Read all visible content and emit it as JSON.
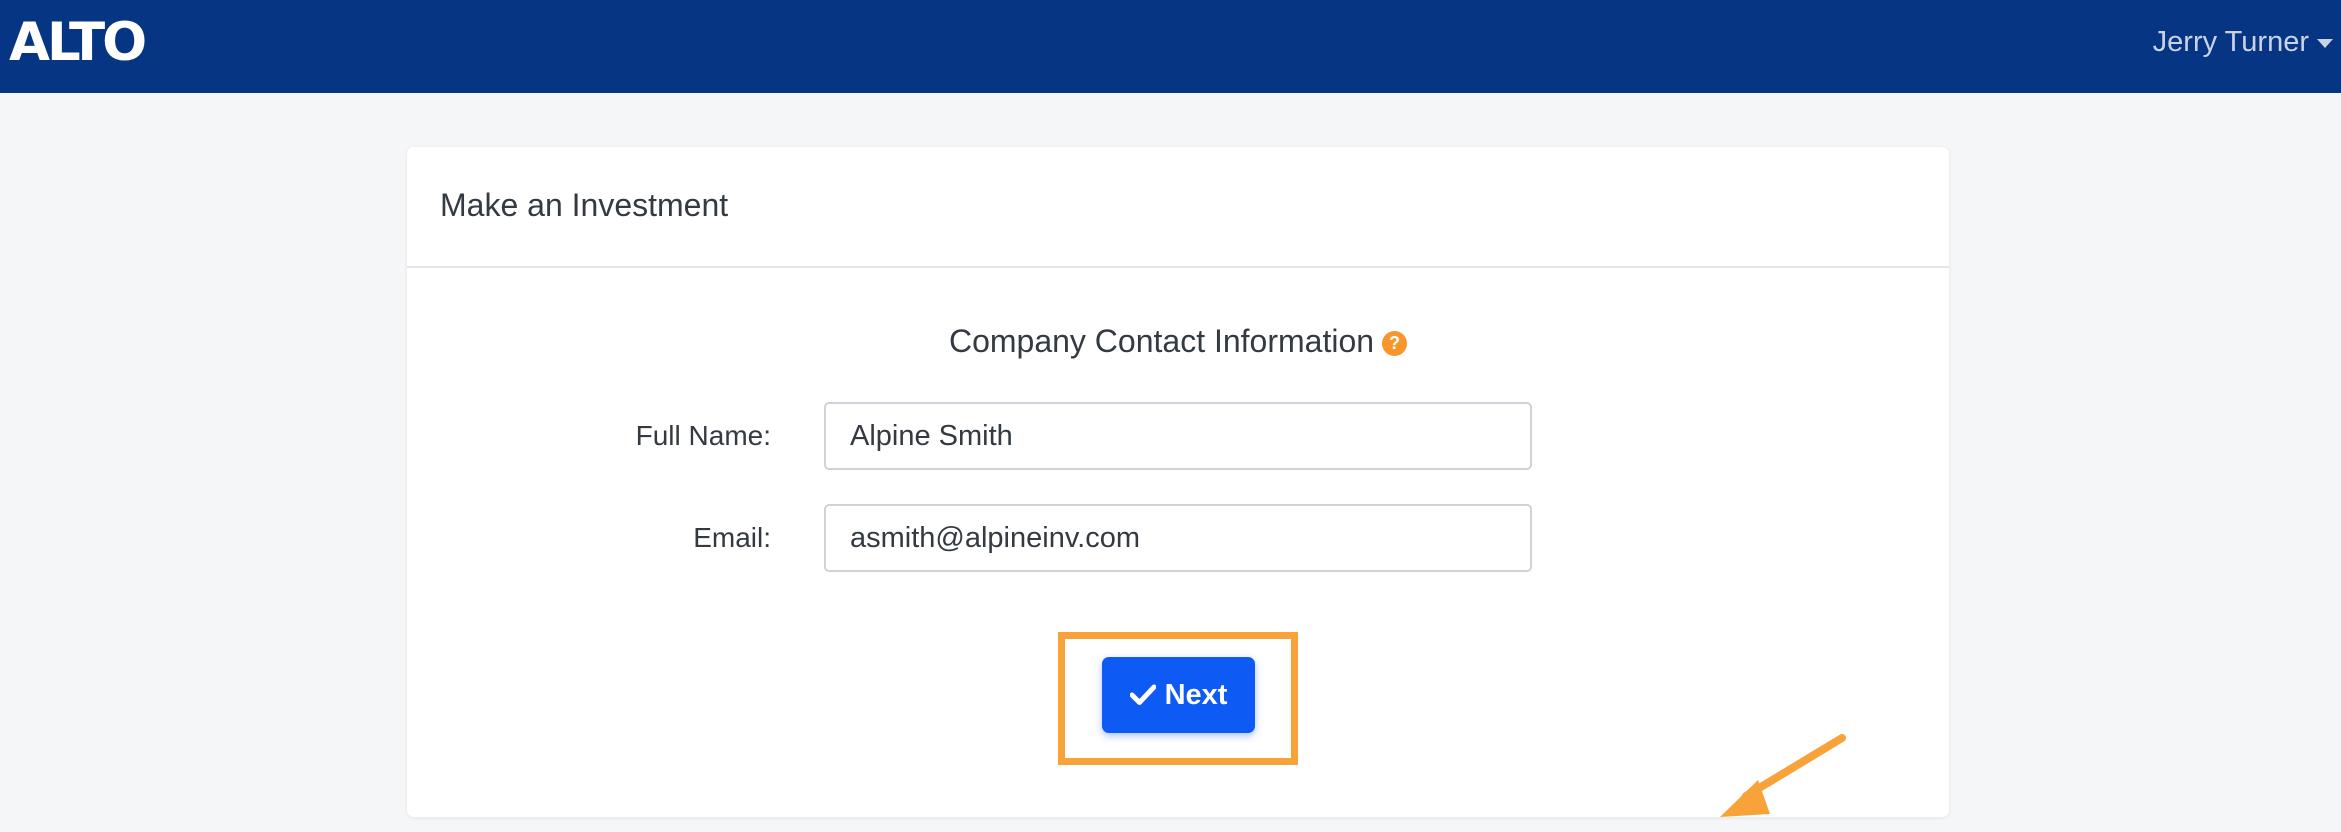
{
  "nav": {
    "logo_text": "ALTO",
    "user_name": "Jerry Turner"
  },
  "card": {
    "title": "Make an Investment",
    "section_title": "Company Contact Information",
    "help_icon": "question-circle-icon",
    "fields": [
      {
        "label": "Full Name:",
        "value": "Alpine Smith"
      },
      {
        "label": "Email:",
        "value": "asmith@alpineinv.com"
      }
    ],
    "next_button": {
      "label": "Next",
      "icon": "check-icon"
    }
  },
  "colors": {
    "navbar": "#053583",
    "page_background": "#f5f6f8",
    "primary_button": "#0d5af5",
    "annotation_orange": "#f7a33a"
  }
}
